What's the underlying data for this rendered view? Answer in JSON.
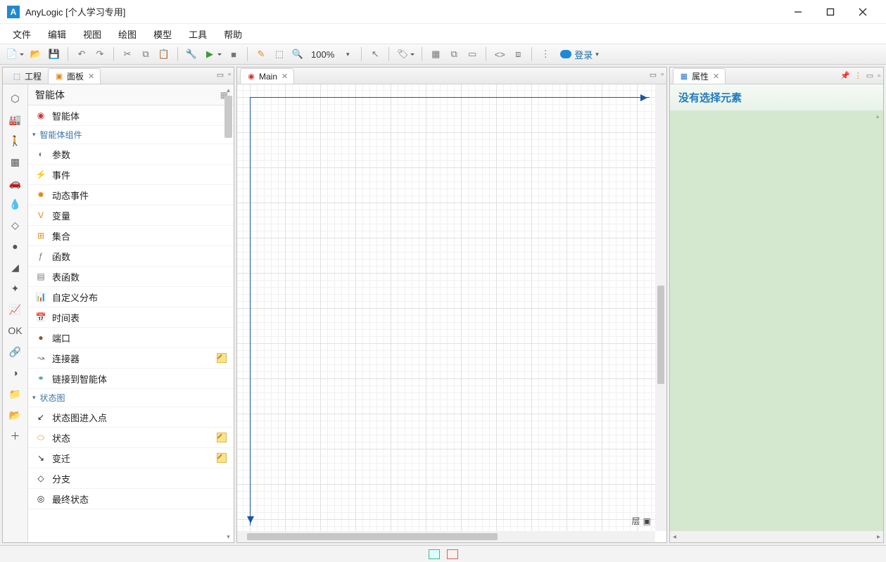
{
  "window": {
    "title": "AnyLogic [个人学习专用]"
  },
  "menu": {
    "file": "文件",
    "edit": "编辑",
    "view": "视图",
    "draw": "绘图",
    "model": "模型",
    "tools": "工具",
    "help": "帮助"
  },
  "toolbar": {
    "zoom": "100%",
    "login": "登录"
  },
  "left": {
    "tabs": {
      "project": "工程",
      "panel": "面板"
    },
    "group_header": "智能体",
    "sections": {
      "components": "智能体组件",
      "statechart": "状态图"
    },
    "items": {
      "agent": "智能体",
      "param": "参数",
      "event": "事件",
      "dyn_event": "动态事件",
      "variable": "变量",
      "collection": "集合",
      "function": "函数",
      "tbl_function": "表函数",
      "cust_dist": "自定义分布",
      "schedule": "时间表",
      "port": "端口",
      "connector": "连接器",
      "link": "链接到智能体",
      "entry": "状态图进入点",
      "state": "状态",
      "transition": "变迁",
      "branch": "分支",
      "final": "最终状态"
    }
  },
  "center": {
    "tab": "Main",
    "layer": "层"
  },
  "right": {
    "tab": "属性",
    "message": "没有选择元素"
  }
}
